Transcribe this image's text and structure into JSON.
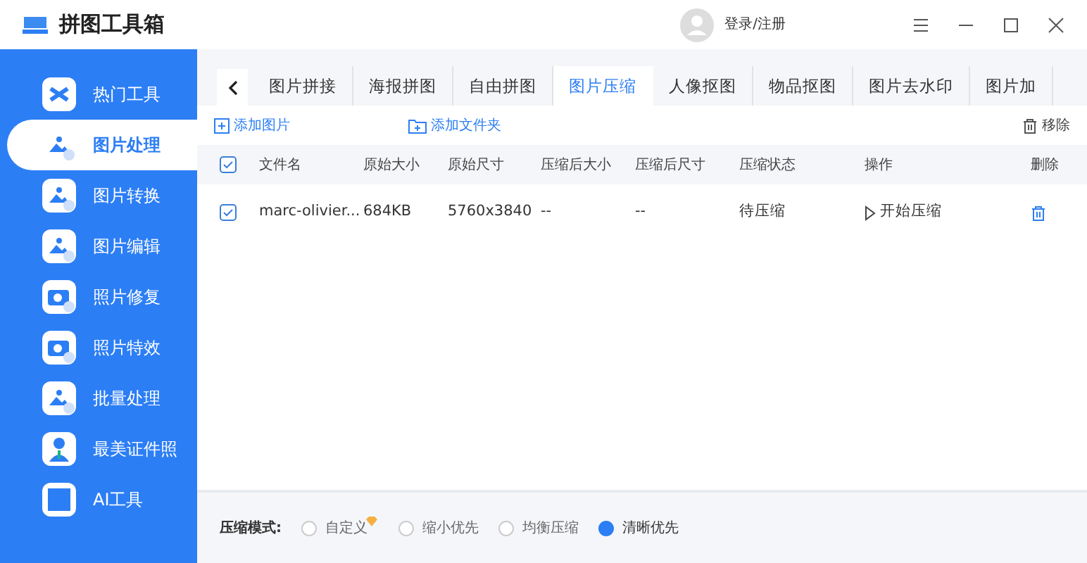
{
  "app": {
    "title": "拼图工具箱",
    "login": "登录/注册"
  },
  "sidebar": {
    "items": [
      {
        "label": "热门工具",
        "selected": false,
        "kind": "tools"
      },
      {
        "label": "图片处理",
        "selected": true,
        "kind": "image"
      },
      {
        "label": "图片转换",
        "selected": false,
        "kind": "image"
      },
      {
        "label": "图片编辑",
        "selected": false,
        "kind": "image"
      },
      {
        "label": "照片修复",
        "selected": false,
        "kind": "camera"
      },
      {
        "label": "照片特效",
        "selected": false,
        "kind": "camera"
      },
      {
        "label": "批量处理",
        "selected": false,
        "kind": "image"
      },
      {
        "label": "最美证件照",
        "selected": false,
        "kind": "person"
      },
      {
        "label": "AI工具",
        "selected": false,
        "kind": "ai"
      }
    ]
  },
  "tabs": [
    {
      "label": "图片拼接",
      "selected": false
    },
    {
      "label": "海报拼图",
      "selected": false
    },
    {
      "label": "自由拼图",
      "selected": false
    },
    {
      "label": "图片压缩",
      "selected": true
    },
    {
      "label": "人像抠图",
      "selected": false
    },
    {
      "label": "物品抠图",
      "selected": false
    },
    {
      "label": "图片去水印",
      "selected": false
    },
    {
      "label": "图片加",
      "selected": false
    }
  ],
  "toolbar": {
    "add_image": "添加图片",
    "add_folder": "添加文件夹",
    "remove": "移除"
  },
  "table": {
    "all_checked": true,
    "columns": [
      "文件名",
      "原始大小",
      "原始尺寸",
      "压缩后大小",
      "压缩后尺寸",
      "压缩状态",
      "操作",
      "删除"
    ],
    "rows": [
      {
        "checked": true,
        "cells": [
          "marc-olivier...",
          "684KB",
          "5760x3840",
          "--",
          "--",
          "待压缩"
        ],
        "action": "开始压缩"
      }
    ]
  },
  "compression": {
    "label": "压缩模式:",
    "options": [
      {
        "label": "自定义",
        "selected": false,
        "vip": true
      },
      {
        "label": "缩小优先",
        "selected": false,
        "vip": false
      },
      {
        "label": "均衡压缩",
        "selected": false,
        "vip": false
      },
      {
        "label": "清晰优先",
        "selected": true,
        "vip": false
      }
    ]
  }
}
